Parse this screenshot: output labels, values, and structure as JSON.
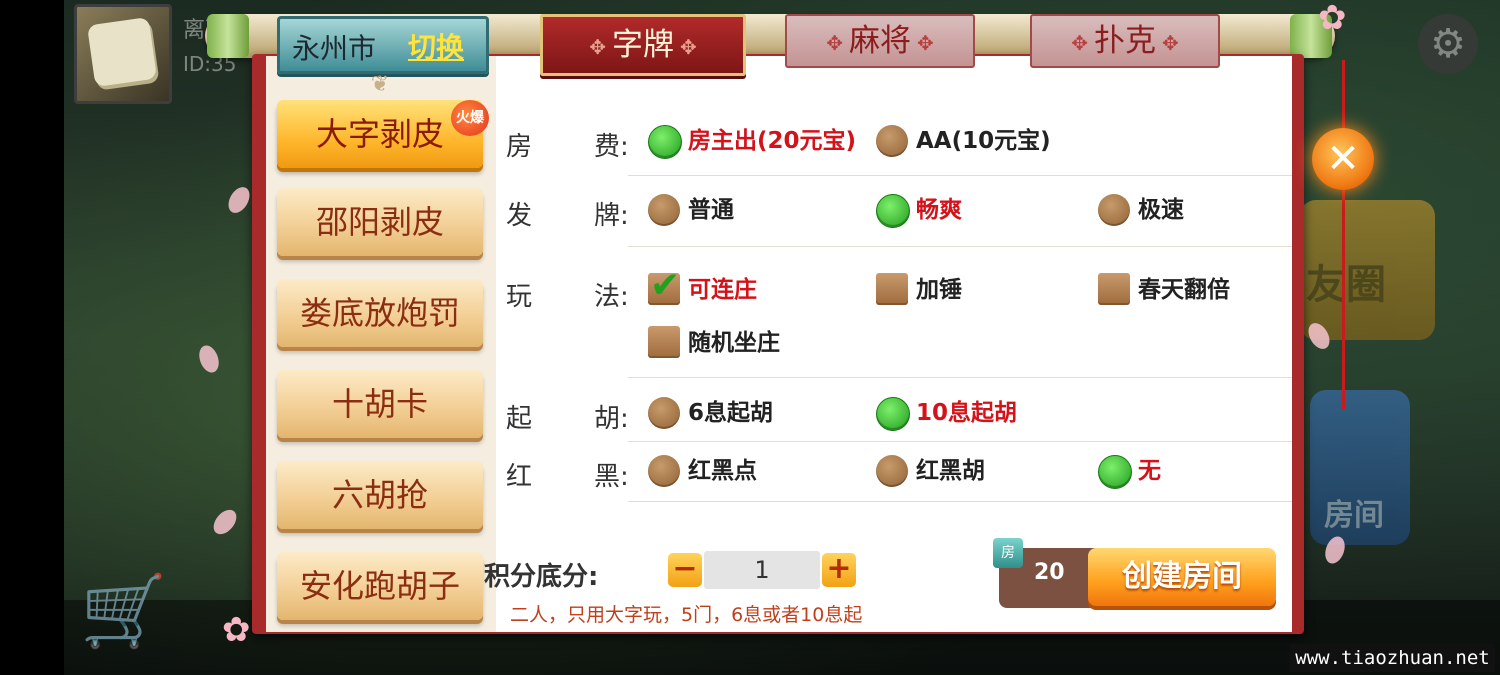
{
  "player": {
    "name": "离雨",
    "id": "ID:35"
  },
  "icons": {
    "settings": "gear-icon",
    "close": "close-icon",
    "check": "check-icon",
    "cart": "shop-cart-icon",
    "cost": "room-card-icon"
  },
  "background_cards": {
    "friends_circle": "友圈",
    "room": "房间"
  },
  "city": {
    "name": "永州市",
    "switch_label": "切换"
  },
  "categories": [
    {
      "label": "字牌",
      "active": true
    },
    {
      "label": "麻将",
      "active": false
    },
    {
      "label": "扑克",
      "active": false
    }
  ],
  "games": [
    {
      "label": "大字剥皮",
      "active": true,
      "badge": "火爆"
    },
    {
      "label": "邵阳剥皮",
      "active": false
    },
    {
      "label": "娄底放炮罚",
      "active": false
    },
    {
      "label": "十胡卡",
      "active": false
    },
    {
      "label": "六胡抢",
      "active": false
    },
    {
      "label": "安化跑胡子",
      "active": false
    }
  ],
  "rules": {
    "room_fee": {
      "label1": "房",
      "label2": "费:",
      "options": [
        {
          "text": "房主出(20元宝)",
          "selected": true
        },
        {
          "text": "AA(10元宝)",
          "selected": false
        }
      ]
    },
    "dealing": {
      "label1": "发",
      "label2": "牌:",
      "options": [
        {
          "text": "普通",
          "selected": false
        },
        {
          "text": "畅爽",
          "selected": true
        },
        {
          "text": "极速",
          "selected": false
        }
      ]
    },
    "play": {
      "label1": "玩",
      "label2": "法:",
      "options": [
        {
          "text": "可连庄",
          "selected": true
        },
        {
          "text": "加锤",
          "selected": false
        },
        {
          "text": "春天翻倍",
          "selected": false
        },
        {
          "text": "随机坐庄",
          "selected": false
        }
      ]
    },
    "start_hu": {
      "label1": "起",
      "label2": "胡:",
      "options": [
        {
          "text": "6息起胡",
          "selected": false
        },
        {
          "text": "10息起胡",
          "selected": true
        }
      ]
    },
    "red_black": {
      "label1": "红",
      "label2": "黑:",
      "options": [
        {
          "text": "红黑点",
          "selected": false
        },
        {
          "text": "红黑胡",
          "selected": false
        },
        {
          "text": "无",
          "selected": true
        }
      ]
    }
  },
  "score": {
    "label": "积分底分:",
    "value": "1",
    "minus": "−",
    "plus": "+"
  },
  "description": "二人，只用大字玩，5门，6息或者10息起",
  "cost": {
    "icon_label": "房",
    "amount": "20"
  },
  "create_button": "创建房间",
  "watermark": "www.tiaozhuan.net",
  "colors": {
    "accent_red": "#a92a2a",
    "selected_green": "#1f9a1c",
    "button_orange": "#ff9f1c",
    "selected_text": "#d4121a"
  }
}
